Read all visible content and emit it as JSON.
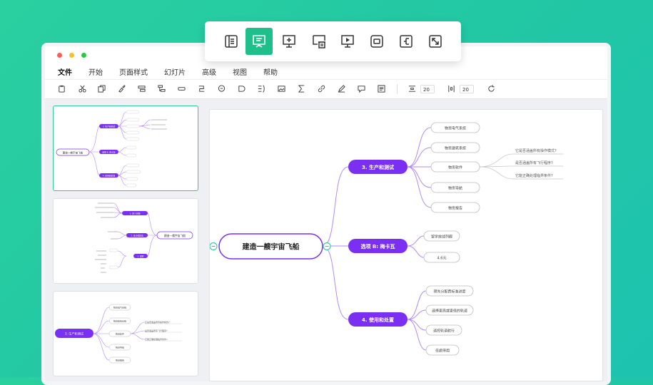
{
  "menu": [
    "文件",
    "开始",
    "页面样式",
    "幻灯片",
    "高级",
    "视图",
    "帮助"
  ],
  "toolbar": {
    "icons": [
      "clipboard-icon",
      "scissors-icon",
      "copy-icon",
      "format-brush-icon",
      "add-topic-icon",
      "add-subtopic-icon",
      "frame-icon",
      "relationship-icon",
      "callout-icon",
      "boundary-icon",
      "summary-icon",
      "image-icon",
      "formula-icon",
      "link-icon",
      "pen-icon",
      "comment-icon",
      "note-icon"
    ],
    "spacing_h": "20",
    "spacing_v": "20"
  },
  "float_toolbar": {
    "icons": [
      "outline-icon",
      "presentation-icon",
      "add-slide-icon",
      "delete-slide-icon",
      "play-icon",
      "fit-icon",
      "layout-icon",
      "fullscreen-icon"
    ],
    "active": "presentation-icon"
  },
  "mindmap": {
    "root": "建造一艘宇宙飞船",
    "branches": [
      {
        "label": "3. 生产和测试",
        "children": [
          "物资电气系统",
          "物资建筑系统",
          "物资软件",
          "物资导航",
          "物资报告"
        ]
      },
      {
        "label": "选项 B: 梅卡瓦",
        "children": [
          "留学放战列舰",
          "4.6元"
        ]
      },
      {
        "label": "4. 使用和处置",
        "children": [
          "预先分配费标准进度",
          "选择更高或更低的轨迹",
          "遥控轨道航行",
          "任旅停用"
        ]
      }
    ],
    "sub_children": [
      "它是否涵盖所有操作模式?",
      "是否涵盖所有飞行程序?",
      "它能正确处理临界条件?"
    ]
  },
  "thumb1": {
    "root": "建造一艘宇宙飞船",
    "branches": [
      "3. 生产和测试",
      "选项 B: 梅卡瓦",
      "4. 使用和处置"
    ]
  },
  "thumb2": {
    "root": "建造一艘宇宙飞船",
    "branches": [
      "1. 定义问题",
      "2. 设计和建造",
      "3. 发射"
    ]
  },
  "thumb3": {
    "branch": "3. 生产和测试",
    "children": [
      "物资电气系统",
      "物资建筑系统",
      "物资软件",
      "物资导航",
      "物资报告"
    ],
    "sub_children": [
      "它是否涵盖所有操作模式?",
      "是否涵盖所有飞行程序?",
      "它能正确处理临界条件?"
    ]
  },
  "colors": {
    "accent": "#7b2ff2",
    "green": "#22c79a",
    "branch_line": "#b28af5"
  }
}
